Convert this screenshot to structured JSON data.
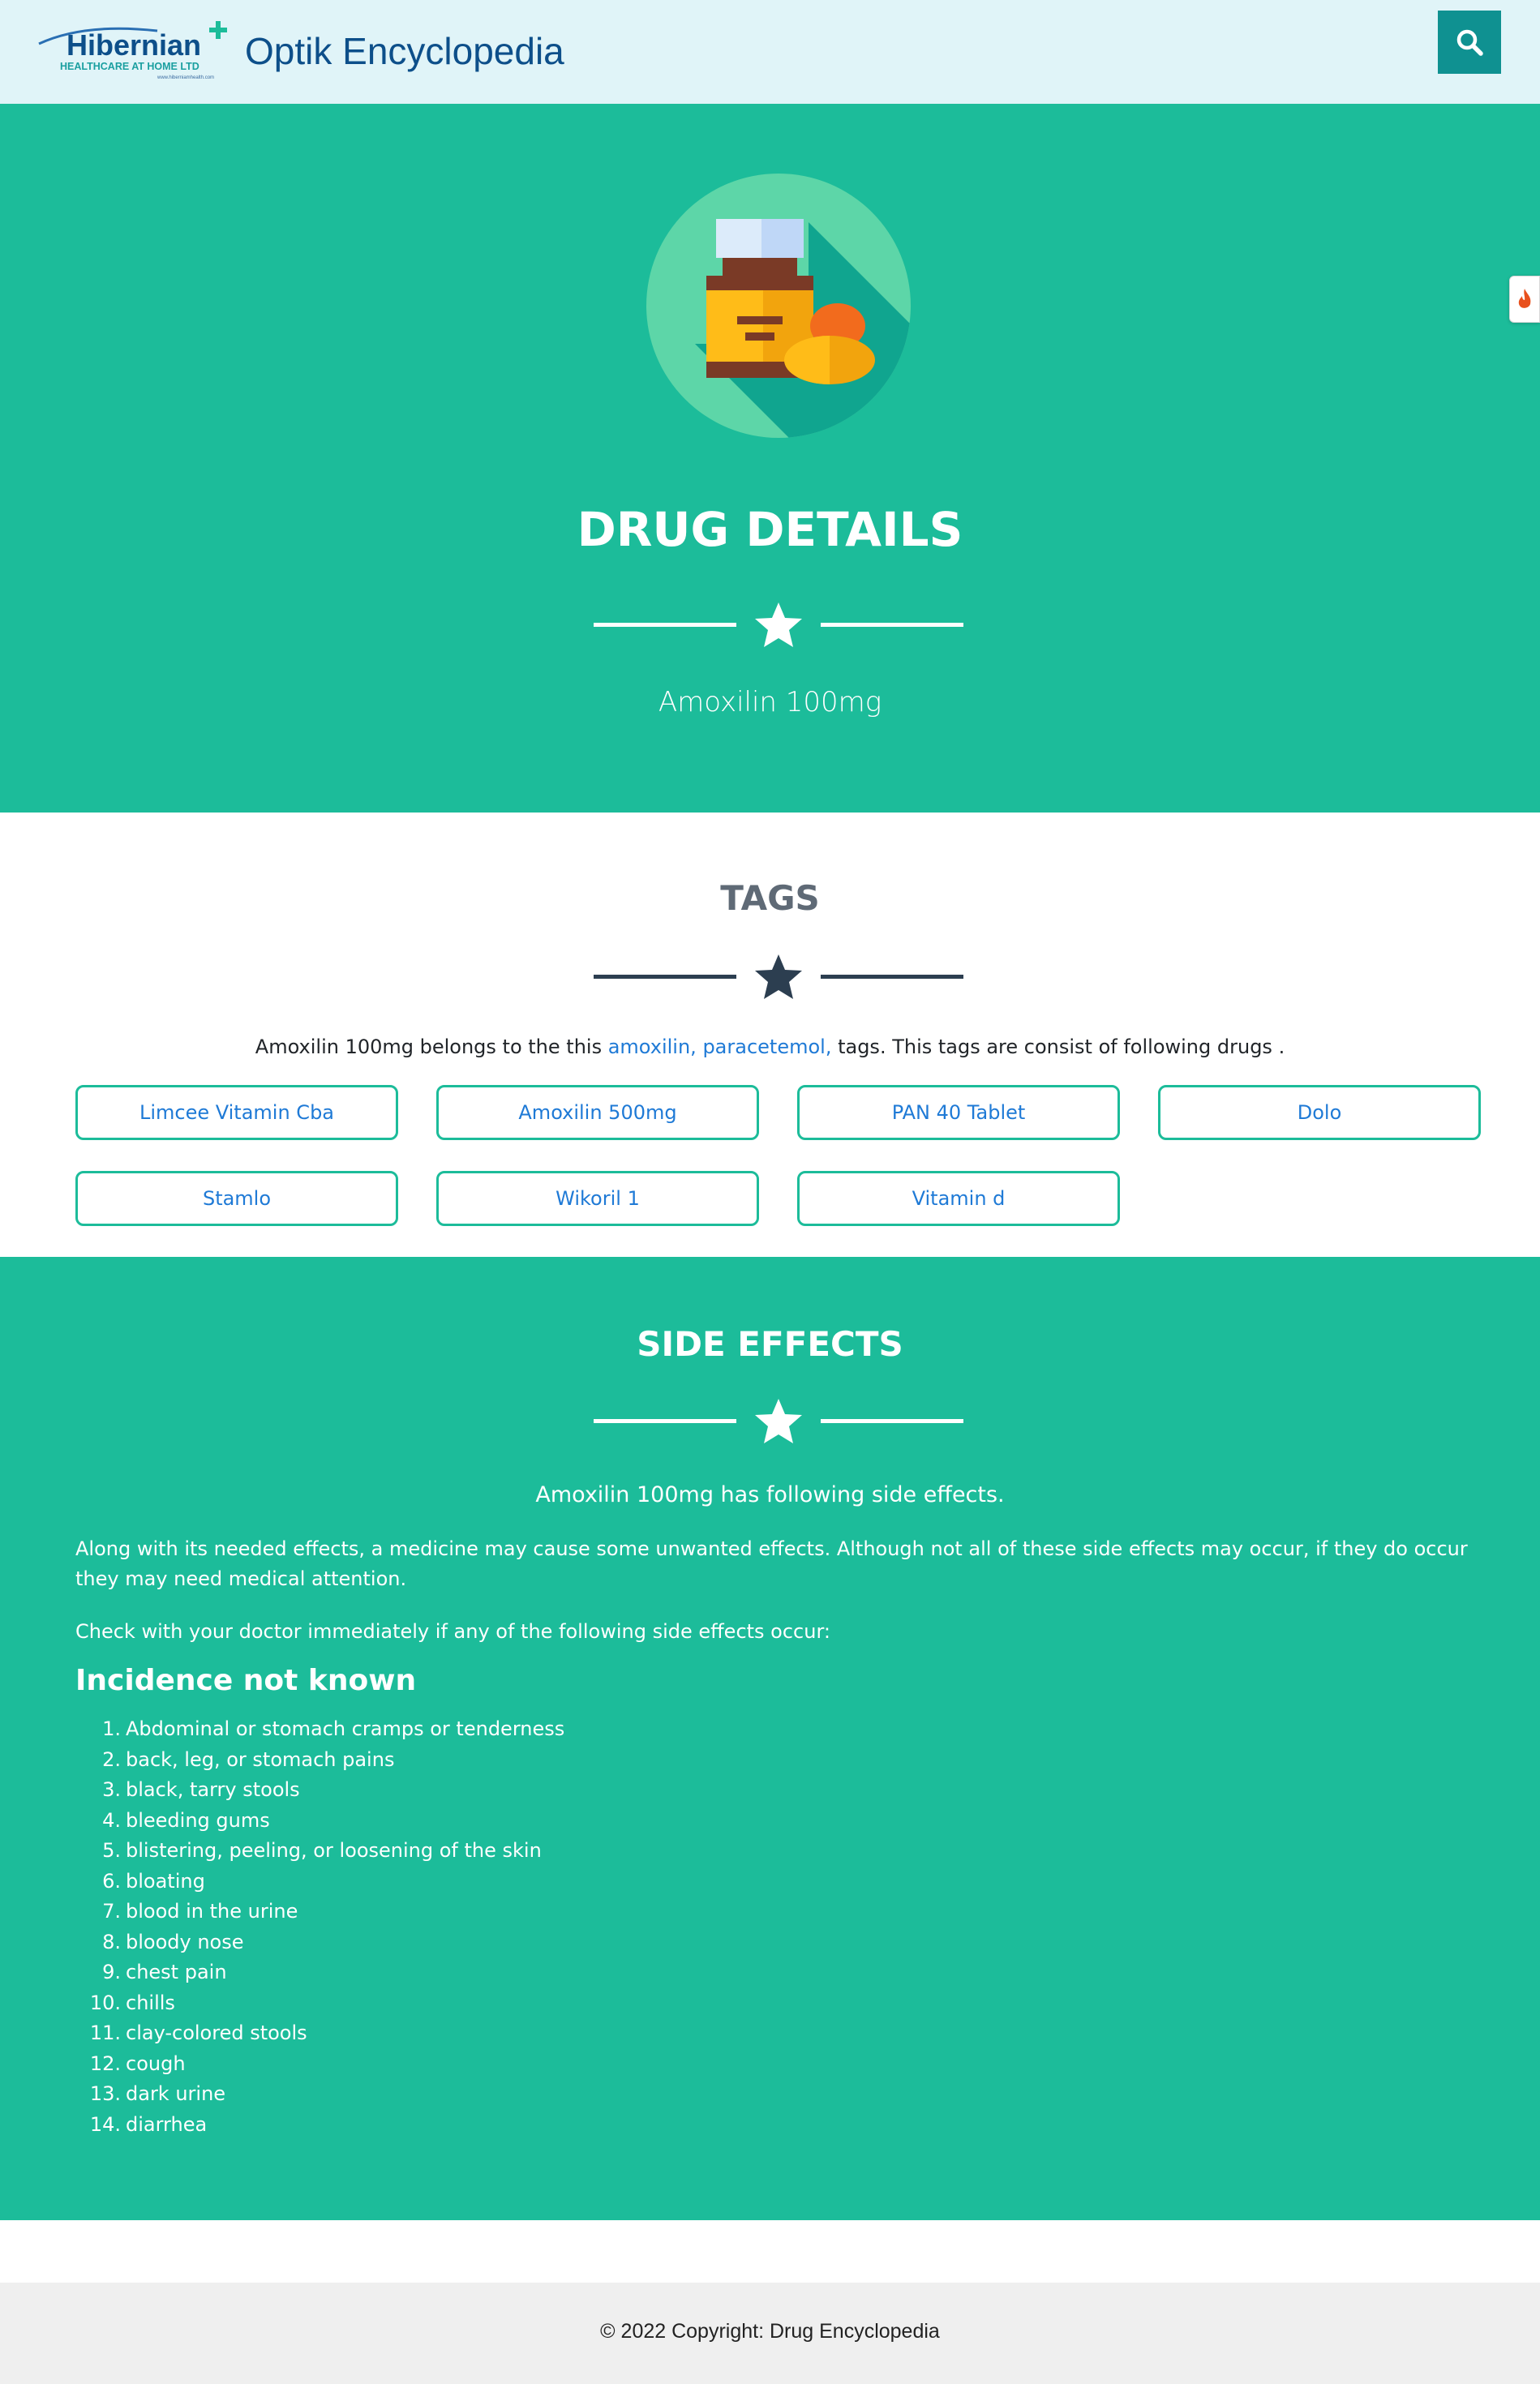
{
  "header": {
    "logo_brand": "Hibernian",
    "logo_tagline": "HEALTHCARE AT HOME LTD",
    "logo_url_text": "www.hiberniamhealth.com",
    "site_title": "Optik Encyclopedia",
    "search_icon": "search-icon"
  },
  "hero": {
    "title": "DRUG DETAILS",
    "drug_name": "Amoxilin 100mg",
    "icon": "medicine-bottle-icon"
  },
  "tags": {
    "title": "TAGS",
    "text_before": "Amoxilin 100mg belongs to the this ",
    "tag_links": [
      "amoxilin,",
      "paracetemol,"
    ],
    "text_after": " tags. This tags are consist of following drugs .",
    "drugs": [
      "Limcee Vitamin Cba",
      "Amoxilin 500mg",
      "PAN 40 Tablet",
      "Dolo",
      "Stamlo",
      "Wikoril 1",
      "Vitamin d"
    ]
  },
  "side_effects": {
    "title": "SIDE EFFECTS",
    "lead": "Amoxilin 100mg has following side effects.",
    "para1": "Along with its needed effects, a medicine may cause some unwanted effects. Although not all of these side effects may occur, if they do occur they may need medical attention.",
    "para2": "Check with your doctor immediately if any of the following side effects occur:",
    "subheading": "Incidence not known",
    "items": [
      "Abdominal or stomach cramps or tenderness",
      "back, leg, or stomach pains",
      "black, tarry stools",
      "bleeding gums",
      "blistering, peeling, or loosening of the skin",
      "bloating",
      "blood in the urine",
      "bloody nose",
      "chest pain",
      "chills",
      "clay-colored stools",
      "cough",
      "dark urine",
      "diarrhea"
    ]
  },
  "footer": {
    "copyright": "© 2022 Copyright: Drug Encyclopedia"
  },
  "colors": {
    "teal": "#1cbc9a",
    "header_bg": "#e0f4f8",
    "search_bg": "#0f9191",
    "link": "#1f7ad6",
    "dark_line": "#2c3e50"
  }
}
